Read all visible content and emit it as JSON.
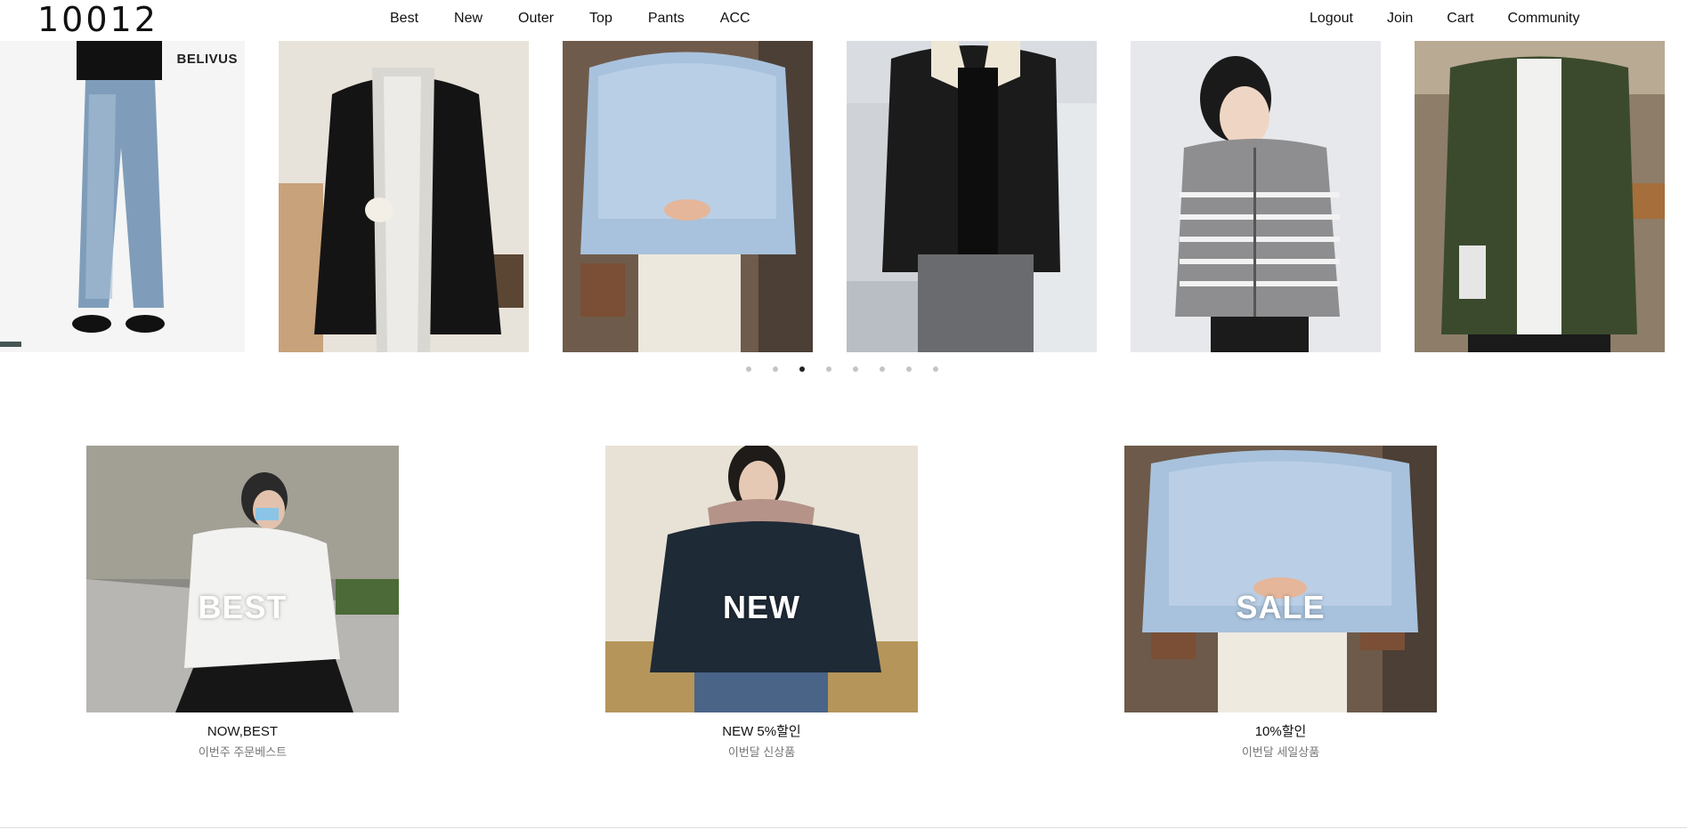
{
  "header": {
    "logo": "10012",
    "nav": [
      "Best",
      "New",
      "Outer",
      "Top",
      "Pants",
      "ACC"
    ],
    "user_links": [
      "Logout",
      "Join",
      "Cart",
      "Community"
    ]
  },
  "slider": {
    "brand_tag": "BELIVUS",
    "slides": [
      {
        "name": "slide-washed-jeans",
        "bg": "#f4f4f4",
        "garment": "#7d9bb8"
      },
      {
        "name": "slide-black-padding",
        "bg": "#e9e4dc",
        "garment": "#151515"
      },
      {
        "name": "slide-blue-fur-knit",
        "bg": "#6d5a4a",
        "garment": "#a9c3de"
      },
      {
        "name": "slide-black-shearling",
        "bg": "#dcdfe3",
        "garment": "#1d1d1d"
      },
      {
        "name": "slide-stripe-knit-zip",
        "bg": "#e5e7eb",
        "garment": "#8d8d8f"
      },
      {
        "name": "slide-khaki-jacket",
        "bg": "#8a7a66",
        "garment": "#3a4a2c"
      }
    ],
    "dots_total": 8,
    "active_dot": 3
  },
  "categories": [
    {
      "overlay": "BEST",
      "title": "NOW,BEST",
      "subtitle": "이번주 주문베스트",
      "bg": "#8c8c86",
      "garment": "#f2f2f0"
    },
    {
      "overlay": "NEW",
      "title": "NEW 5%할인",
      "subtitle": "이번달 신상품",
      "bg": "#e6e0d4",
      "garment": "#1e2a36"
    },
    {
      "overlay": "SALE",
      "title": "10%할인",
      "subtitle": "이번달 세일상품",
      "bg": "#6d5a4a",
      "garment": "#a9c3de"
    }
  ]
}
